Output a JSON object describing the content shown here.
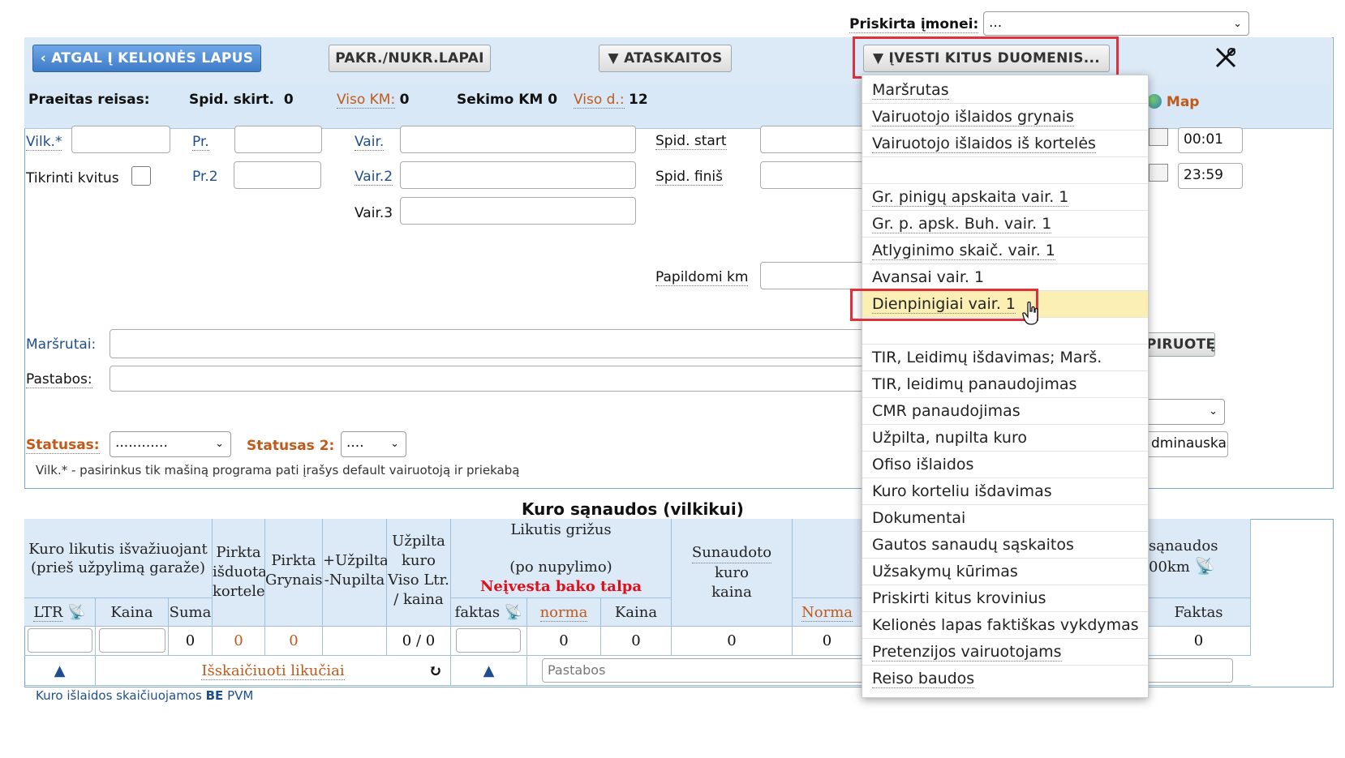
{
  "assigned": {
    "label": "Priskirta įmonei:",
    "value": "..."
  },
  "toolbar": {
    "back": "ATGAL Į KELIONĖS LAPUS",
    "loading": "PAKR./NUKR.LAPAI",
    "reports": "ATASKAITOS",
    "other": "ĮVESTI KITUS DUOMENIS..."
  },
  "info": {
    "prev_trip": "Praeitas reisas:",
    "speed_diff_label": "Spid. skirt.",
    "speed_diff_value": "0",
    "total_km_label": "Viso KM:",
    "total_km_value": "0",
    "tracking_km_label": "Sekimo KM",
    "tracking_km_value": "0",
    "total_days_label": "Viso d.:",
    "total_days_value": "12",
    "map": "Map"
  },
  "form": {
    "truck": "Vilk.*",
    "check_receipt": "Tikrinti kvitus",
    "trailer": "Pr.",
    "trailer2": "Pr.2",
    "driver": "Vair.",
    "driver2": "Vair.2",
    "driver3": "Vair.3",
    "speed_start": "Spid. start",
    "speed_finish": "Spid. finiš",
    "extra_km": "Papildomi km",
    "time_start": "00:01",
    "time_end": "23:59",
    "routes": "Maršrutai:",
    "notes": "Pastabos:",
    "status": "Statusas:",
    "status_value": "............",
    "status2": "Statusas 2:",
    "status2_value": "....",
    "copy_btn": "PIRUOTĘ",
    "user_value": "dminauskas",
    "hint": "Vilk.* - pasirinkus tik mašiną programa pati įrašys default vairuotoją ir priekabą"
  },
  "menu": {
    "items": [
      "Maršrutas",
      "Vairuotojo išlaidos grynais",
      "Vairuotojo išlaidos iš kortelės",
      "",
      "Gr. pinigų apskaita vair. 1",
      "Gr. p. apsk. Buh. vair. 1",
      "Atlyginimo skaič. vair. 1",
      "Avansai vair. 1",
      "Dienpinigiai vair. 1",
      "",
      "TIR, Leidimų išdavimas; Marš.",
      "TIR, leidimų panaudojimas",
      "CMR panaudojimas",
      "Užpilta, nupilta kuro",
      "Ofiso išlaidos",
      "Kuro korteliu išdavimas",
      "Dokumentai",
      "Gautos sanaudų sąskaitos",
      "Užsakymų kūrimas",
      "Priskirti kitus krovinius",
      "Kelionės lapas faktiškas vykdymas",
      "Pretenzijos vairuotojams",
      "Reiso baudos"
    ]
  },
  "fuel": {
    "title": "Kuro sąnaudos (vilkikui)",
    "h_left1": "Kuro likutis išvažiuojant",
    "h_left2": "(prieš užpylimą garaže)",
    "h_card1": "Pirkta",
    "h_card2": "išduota",
    "h_card3": "kortele",
    "h_cash1": "Pirkta",
    "h_cash2": "Grynais",
    "h_pour1": "+Užpilta",
    "h_pour2": "-Nupilta",
    "h_poured1": "Užpilta",
    "h_poured2": "kuro",
    "h_poured3": "Viso Ltr.",
    "h_poured4": "/ kaina",
    "h_return1": "Likutis grižus",
    "h_return2": "(po nupylimo)",
    "h_return_warn": "Neįvesta bako talpa",
    "h_used1": "Sunaudoto",
    "h_used2": "kuro",
    "h_used3": "kaina",
    "h_cons1": "sąnaudos",
    "h_cons2": "00km",
    "ltr": "LTR",
    "price": "Kaina",
    "sum": "Suma",
    "fact": "faktas",
    "norm": "norma",
    "price2": "Kaina",
    "norm2": "Norma",
    "fact2": "Faktas",
    "v_sum": "0",
    "v_card": "0",
    "v_cash": "0",
    "v_poured": "0 / 0",
    "v_norm": "0",
    "v_price": "0",
    "v_used": "0",
    "v_norm2": "0",
    "v_fact2": "0",
    "calc": "Išskaičiuoti likučiai",
    "notes_placeholder": "Pastabos",
    "footnote_pre": "Kuro išlaidos skaičiuojamos",
    "footnote_be": "BE",
    "footnote_post": "PVM"
  }
}
